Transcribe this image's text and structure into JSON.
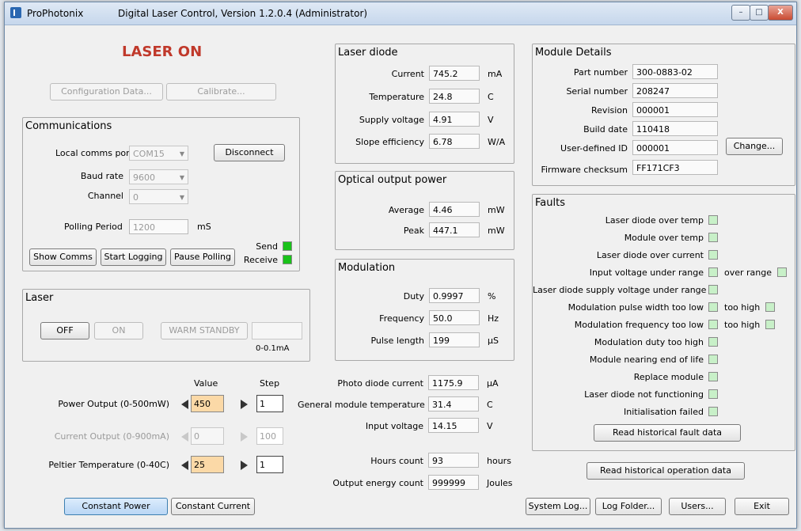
{
  "window": {
    "app_name": "ProPhotonix",
    "title": "Digital Laser Control, Version 1.2.0.4 (Administrator)",
    "minimize_label": "–",
    "maximize_label": "□",
    "close_label": "X"
  },
  "status": {
    "laser_state": "LASER ON",
    "color": "#c0392b"
  },
  "top_buttons": {
    "configuration": "Configuration Data...",
    "calibrate": "Calibrate..."
  },
  "communications": {
    "title": "Communications",
    "port_label": "Local comms port",
    "port_value": "COM15",
    "disconnect": "Disconnect",
    "baud_label": "Baud rate",
    "baud_value": "9600",
    "channel_label": "Channel",
    "channel_value": "0",
    "polling_label": "Polling Period",
    "polling_value": "1200",
    "polling_unit": "mS",
    "show_comms": "Show Comms",
    "start_logging": "Start Logging",
    "pause_polling": "Pause Polling",
    "send_label": "Send",
    "receive_label": "Receive"
  },
  "laser": {
    "title": "Laser",
    "off": "OFF",
    "on": "ON",
    "warm_standby": "WARM STANDBY",
    "range": "0-0.1mA"
  },
  "controls": {
    "value_header": "Value",
    "step_header": "Step",
    "power_label": "Power Output (0-500mW)",
    "power_value": "450",
    "power_step": "1",
    "current_label": "Current Output (0-900mA)",
    "current_value": "0",
    "current_step": "100",
    "peltier_label": "Peltier Temperature (0-40C)",
    "peltier_value": "25",
    "peltier_step": "1",
    "constant_power": "Constant Power",
    "constant_current": "Constant Current"
  },
  "laser_diode": {
    "title": "Laser diode",
    "current_label": "Current",
    "current_value": "745.2",
    "current_unit": "mA",
    "temp_label": "Temperature",
    "temp_value": "24.8",
    "temp_unit": "C",
    "supply_label": "Supply voltage",
    "supply_value": "4.91",
    "supply_unit": "V",
    "slope_label": "Slope efficiency",
    "slope_value": "6.78",
    "slope_unit": "W/A"
  },
  "optical": {
    "title": "Optical output power",
    "avg_label": "Average",
    "avg_value": "4.46",
    "avg_unit": "mW",
    "peak_label": "Peak",
    "peak_value": "447.1",
    "peak_unit": "mW"
  },
  "modulation": {
    "title": "Modulation",
    "duty_label": "Duty",
    "duty_value": "0.9997",
    "duty_unit": "%",
    "freq_label": "Frequency",
    "freq_value": "50.0",
    "freq_unit": "Hz",
    "pulse_label": "Pulse length",
    "pulse_value": "199",
    "pulse_unit": "µS"
  },
  "readings": {
    "photo_label": "Photo diode current",
    "photo_value": "1175.9",
    "photo_unit": "µA",
    "gmt_label": "General module temperature",
    "gmt_value": "31.4",
    "gmt_unit": "C",
    "input_label": "Input voltage",
    "input_value": "14.15",
    "input_unit": "V",
    "hours_label": "Hours count",
    "hours_value": "93",
    "hours_unit": "hours",
    "energy_label": "Output energy count",
    "energy_value": "999999",
    "energy_unit": "Joules"
  },
  "module": {
    "title": "Module Details",
    "part_label": "Part number",
    "part_value": "300-0883-02",
    "serial_label": "Serial number",
    "serial_value": "208247",
    "revision_label": "Revision",
    "revision_value": "000001",
    "build_label": "Build date",
    "build_value": "110418",
    "uid_label": "User-defined ID",
    "uid_value": "000001",
    "change": "Change...",
    "fw_label": "Firmware checksum",
    "fw_value": "FF171CF3"
  },
  "faults": {
    "title": "Faults",
    "f1": "Laser diode over temp",
    "f2": "Module over temp",
    "f3": "Laser diode over current",
    "f4": "Input voltage under range",
    "f4b": "over range",
    "f5": "Laser diode supply voltage under range",
    "f6": "Modulation pulse width too low",
    "f6b": "too high",
    "f7": "Modulation frequency too low",
    "f7b": "too high",
    "f8": "Modulation duty too high",
    "f9": "Module nearing end of life",
    "f10": "Replace module",
    "f11": "Laser diode not functioning",
    "f12": "Initialisation failed",
    "read_faults": "Read historical fault data"
  },
  "bottom": {
    "read_operation": "Read historical operation data",
    "system_log": "System Log...",
    "log_folder": "Log Folder...",
    "users": "Users...",
    "exit": "Exit"
  }
}
